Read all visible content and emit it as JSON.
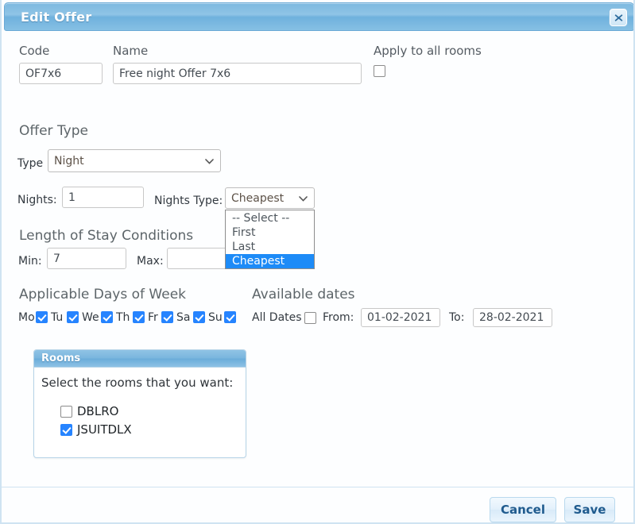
{
  "dialog": {
    "title": "Edit Offer",
    "close_icon": "close-icon"
  },
  "top_fields": {
    "code_label": "Code",
    "code_value": "OF7x6",
    "name_label": "Name",
    "name_value": "Free night Offer 7x6",
    "apply_all_label": "Apply to all rooms",
    "apply_all_checked": false
  },
  "offer_type": {
    "heading": "Offer Type",
    "type_label": "Type",
    "type_value": "Night",
    "type_options": [
      "Night"
    ],
    "nights_label": "Nights:",
    "nights_value": "1",
    "nights_type_label": "Nights Type:",
    "nights_type_value": "Cheapest",
    "nights_type_options": [
      "-- Select --",
      "First",
      "Last",
      "Cheapest"
    ],
    "nights_type_selected_index": 3
  },
  "length_of_stay": {
    "heading": "Length of Stay Conditions",
    "min_label": "Min:",
    "min_value": "7",
    "max_label": "Max:",
    "max_value": ""
  },
  "days_of_week": {
    "heading": "Applicable Days of Week",
    "days": [
      {
        "label": "Mo",
        "checked": true
      },
      {
        "label": "Tu",
        "checked": true
      },
      {
        "label": "We",
        "checked": true
      },
      {
        "label": "Th",
        "checked": true
      },
      {
        "label": "Fr",
        "checked": true
      },
      {
        "label": "Sa",
        "checked": true
      },
      {
        "label": "Su",
        "checked": true
      }
    ]
  },
  "available_dates": {
    "heading": "Available dates",
    "all_dates_label": "All Dates",
    "all_dates_checked": false,
    "from_label": "From:",
    "from_value": "01-02-2021",
    "to_label": "To:",
    "to_value": "28-02-2021"
  },
  "rooms": {
    "panel_title": "Rooms",
    "hint": "Select the rooms that you want:",
    "items": [
      {
        "label": "DBLRO",
        "checked": false
      },
      {
        "label": "JSUITDLX",
        "checked": true
      }
    ]
  },
  "footer": {
    "cancel_label": "Cancel",
    "save_label": "Save"
  },
  "colors": {
    "title_bar": "#7cb9e0",
    "accent_checkbox": "#2684ff",
    "dropdown_highlight": "#1d8bf7",
    "button_text": "#1f5b8e",
    "panel_border": "#b7d4e8"
  }
}
